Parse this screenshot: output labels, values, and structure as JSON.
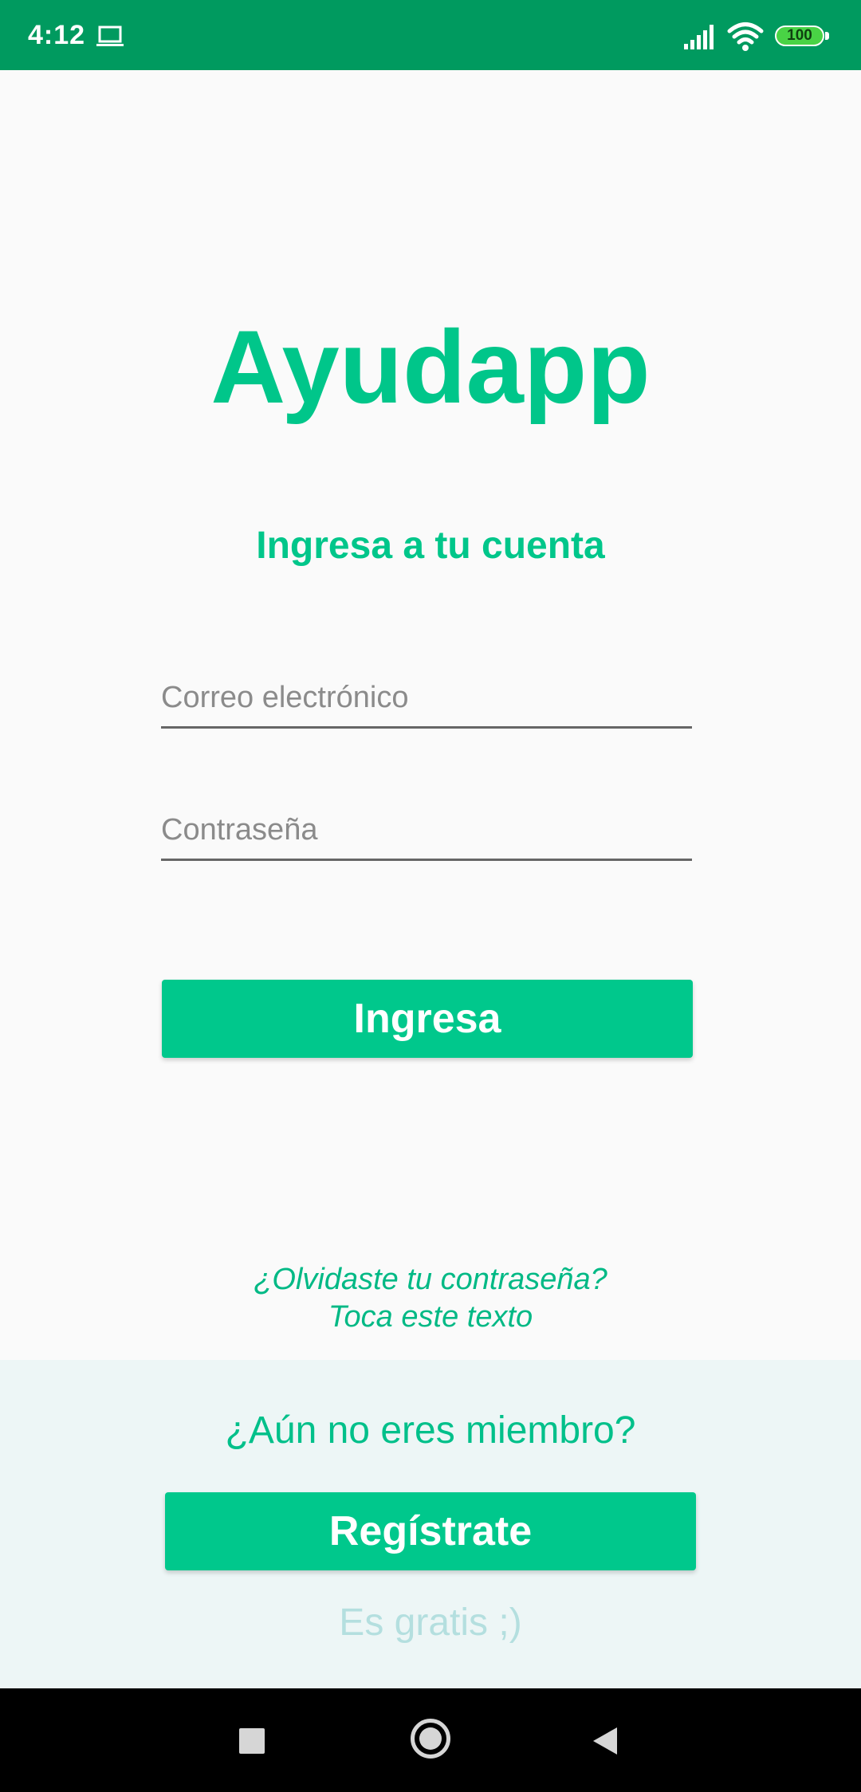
{
  "status_bar": {
    "time": "4:12",
    "battery_level": "100",
    "background_color": "#009a5f",
    "icons": [
      "laptop-icon",
      "signal-icon",
      "wifi-icon",
      "battery-icon"
    ]
  },
  "app": {
    "title": "Ayudapp",
    "accent_color": "#00c88c"
  },
  "login": {
    "heading": "Ingresa a tu cuenta",
    "email_placeholder": "Correo electrónico",
    "email_value": "",
    "password_placeholder": "Contraseña",
    "password_value": "",
    "submit_label": "Ingresa"
  },
  "forgot_password": {
    "line1": "¿Olvidaste tu contraseña?",
    "line2": "Toca este texto"
  },
  "signup": {
    "question": "¿Aún no eres miembro?",
    "button_label": "Regístrate",
    "note": "Es gratis ;)"
  },
  "nav_bar": {
    "icons": [
      "recent-apps-icon",
      "home-icon",
      "back-icon"
    ]
  }
}
